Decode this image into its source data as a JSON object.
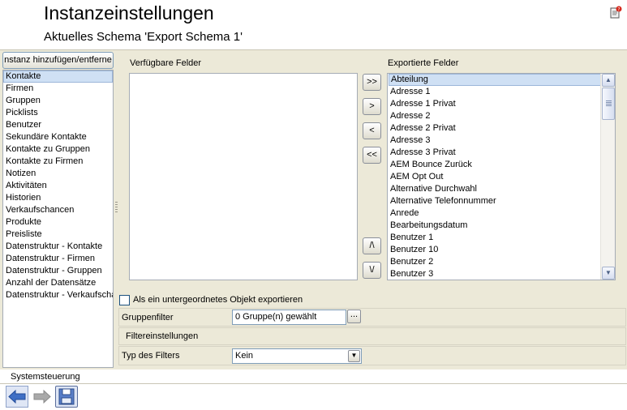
{
  "header": {
    "title": "Instanzeinstellungen",
    "subtitle": "Aktuelles Schema 'Export Schema 1'"
  },
  "left_pane": {
    "add_remove_label": "nstanz hinzufügen/entferne",
    "items": [
      {
        "label": "Kontakte",
        "selected": true
      },
      {
        "label": "Firmen"
      },
      {
        "label": "Gruppen"
      },
      {
        "label": "Picklists"
      },
      {
        "label": "Benutzer"
      },
      {
        "label": "Sekundäre Kontakte"
      },
      {
        "label": "Kontakte zu Gruppen"
      },
      {
        "label": "Kontakte zu Firmen"
      },
      {
        "label": "Notizen"
      },
      {
        "label": "Aktivitäten"
      },
      {
        "label": "Historien"
      },
      {
        "label": "Verkaufschancen"
      },
      {
        "label": "Produkte"
      },
      {
        "label": "Preisliste"
      },
      {
        "label": "Datenstruktur - Kontakte"
      },
      {
        "label": "Datenstruktur - Firmen"
      },
      {
        "label": "Datenstruktur - Gruppen"
      },
      {
        "label": "Anzahl der Datensätze"
      },
      {
        "label": "Datenstruktur - Verkaufschancen"
      }
    ]
  },
  "fields": {
    "available_label": "Verfügbare Felder",
    "exported_label": "Exportierte Felder",
    "available": [],
    "exported": [
      "Abteilung",
      "Adresse 1",
      "Adresse 1 Privat",
      "Adresse 2",
      "Adresse 2 Privat",
      "Adresse 3",
      "Adresse 3 Privat",
      "AEM Bounce Zurück",
      "AEM Opt Out",
      "Alternative Durchwahl",
      "Alternative Telefonnummer",
      "Anrede",
      "Bearbeitungsdatum",
      "Benutzer 1",
      "Benutzer 10",
      "Benutzer 2",
      "Benutzer 3"
    ],
    "exported_selected_index": 0,
    "buttons": {
      "add_all": ">>",
      "add": ">",
      "remove": "<",
      "remove_all": "<<",
      "move_up": "/\\",
      "move_down": "\\/"
    }
  },
  "options": {
    "sub_object_label": "Als ein untergeordnetes Objekt exportieren",
    "sub_object_checked": false,
    "group_filter_label": "Gruppenfilter",
    "group_filter_value": "0 Gruppe(n) gewählt",
    "group_filter_button": "...",
    "filter_settings_heading": "Filtereinstellungen",
    "filter_type_label": "Typ des Filters",
    "filter_type_value": "Kein"
  },
  "footer": {
    "system_control_label": "Systemsteuerung"
  },
  "colors": {
    "panel": "#ece9d8",
    "selection": "#cfe0f4",
    "nav_blue": "#3f6fc5"
  },
  "icons": {
    "help": "help-document-icon",
    "back": "back-arrow-icon",
    "forward": "forward-arrow-icon",
    "save": "floppy-disk-icon"
  }
}
